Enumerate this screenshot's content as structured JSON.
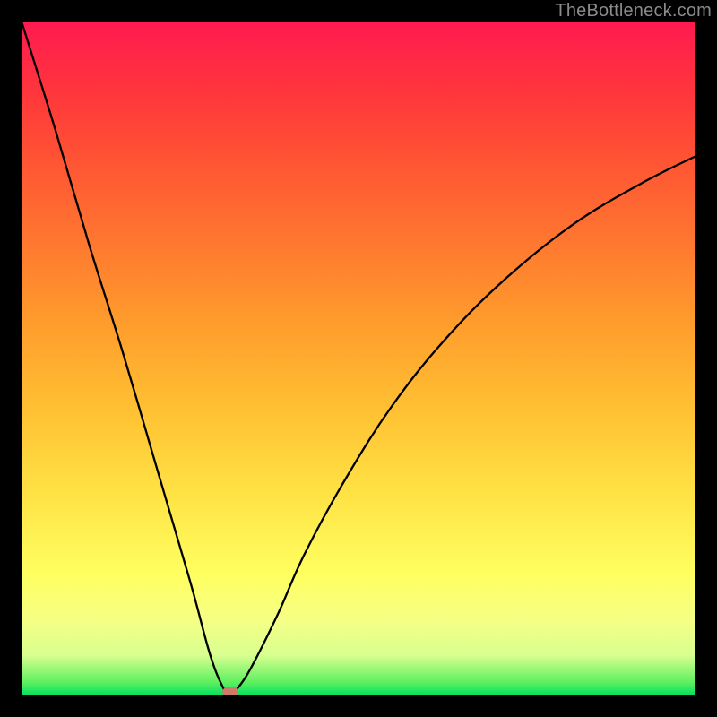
{
  "watermark": "TheBottleneck.com",
  "chart_data": {
    "type": "line",
    "title": "",
    "xlabel": "",
    "ylabel": "",
    "xlim": [
      0,
      100
    ],
    "ylim": [
      0,
      100
    ],
    "series": [
      {
        "name": "bottleneck-curve",
        "x": [
          0,
          5,
          10,
          15,
          20,
          25,
          28,
          30,
          31,
          32,
          34,
          38,
          42,
          48,
          55,
          63,
          72,
          82,
          92,
          100
        ],
        "values": [
          100,
          84,
          67,
          51,
          34,
          17,
          6,
          1,
          0,
          1,
          4,
          12,
          21,
          32,
          43,
          53,
          62,
          70,
          76,
          80
        ]
      }
    ],
    "marker": {
      "x": 31,
      "y": 0,
      "color": "#d07a6a"
    },
    "background_gradient": {
      "bottom": "#00e060",
      "mid": "#ffff60",
      "top": "#ff1a50"
    }
  }
}
